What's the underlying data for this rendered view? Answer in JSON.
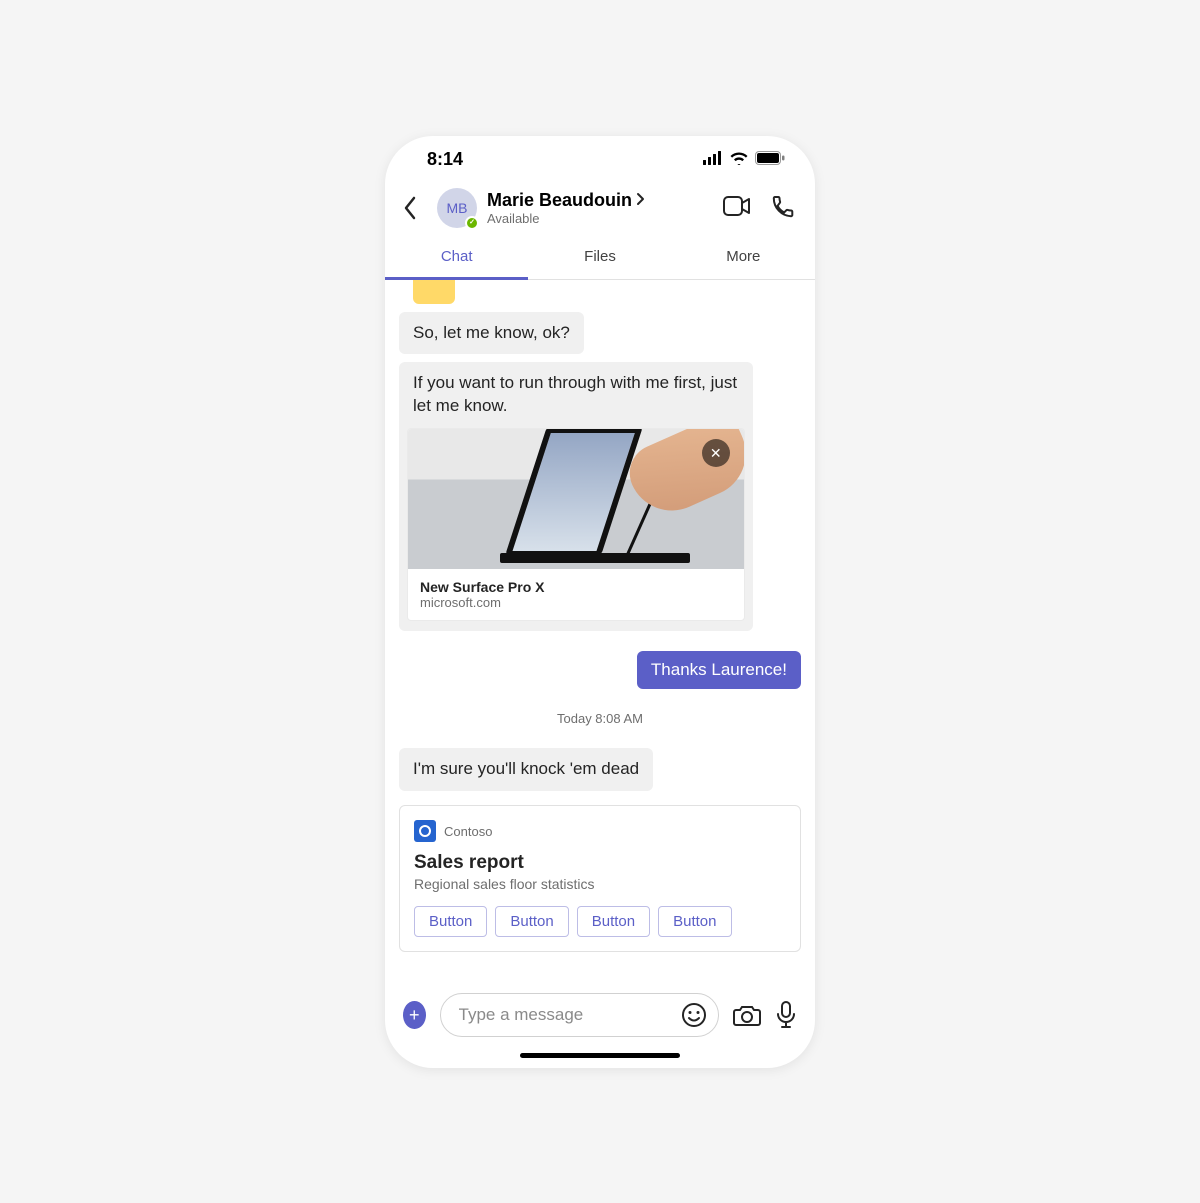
{
  "statusBar": {
    "time": "8:14"
  },
  "header": {
    "avatarInitials": "MB",
    "contactName": "Marie Beaudouin",
    "presenceText": "Available"
  },
  "tabs": {
    "chat": "Chat",
    "files": "Files",
    "more": "More"
  },
  "messages": {
    "m1": "So, let me know, ok?",
    "m2": "If you want to run through with me first, just let me know.",
    "linkPreview": {
      "title": "New Surface Pro X",
      "domain": "microsoft.com"
    },
    "m3": "Thanks Laurence!",
    "timestamp": "Today 8:08 AM",
    "m4": "I'm sure you'll knock 'em dead"
  },
  "appCard": {
    "appName": "Contoso",
    "title": "Sales report",
    "subtitle": "Regional sales floor statistics",
    "buttons": [
      "Button",
      "Button",
      "Button",
      "Button"
    ]
  },
  "composer": {
    "placeholder": "Type a message"
  }
}
